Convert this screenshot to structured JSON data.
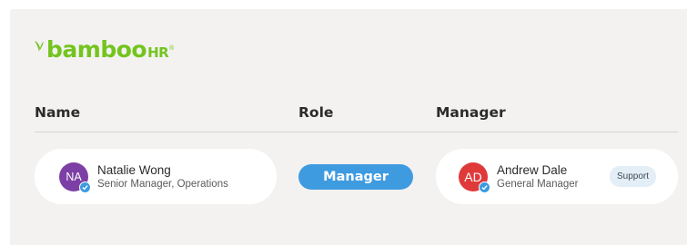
{
  "brand": {
    "name_main": "bamboo",
    "name_suffix": "HR",
    "registered": "®",
    "color": "#73c41d"
  },
  "table": {
    "headers": {
      "name": "Name",
      "role": "Role",
      "manager": "Manager"
    },
    "row": {
      "employee": {
        "initials": "NA",
        "name": "Natalie Wong",
        "title": "Senior Manager, Operations",
        "avatar_color": "#7c3fa5",
        "verified_icon": "check-badge-icon"
      },
      "role": {
        "label": "Manager",
        "color": "#3f9be0"
      },
      "manager": {
        "initials": "AD",
        "name": "Andrew Dale",
        "title": "General Manager",
        "avatar_color": "#e0393a",
        "verified_icon": "check-badge-icon",
        "tag": "Support"
      }
    }
  },
  "colors": {
    "panel_bg": "#f3f2f1",
    "card_bg": "#ffffff",
    "accent_blue": "#3a9be0"
  }
}
